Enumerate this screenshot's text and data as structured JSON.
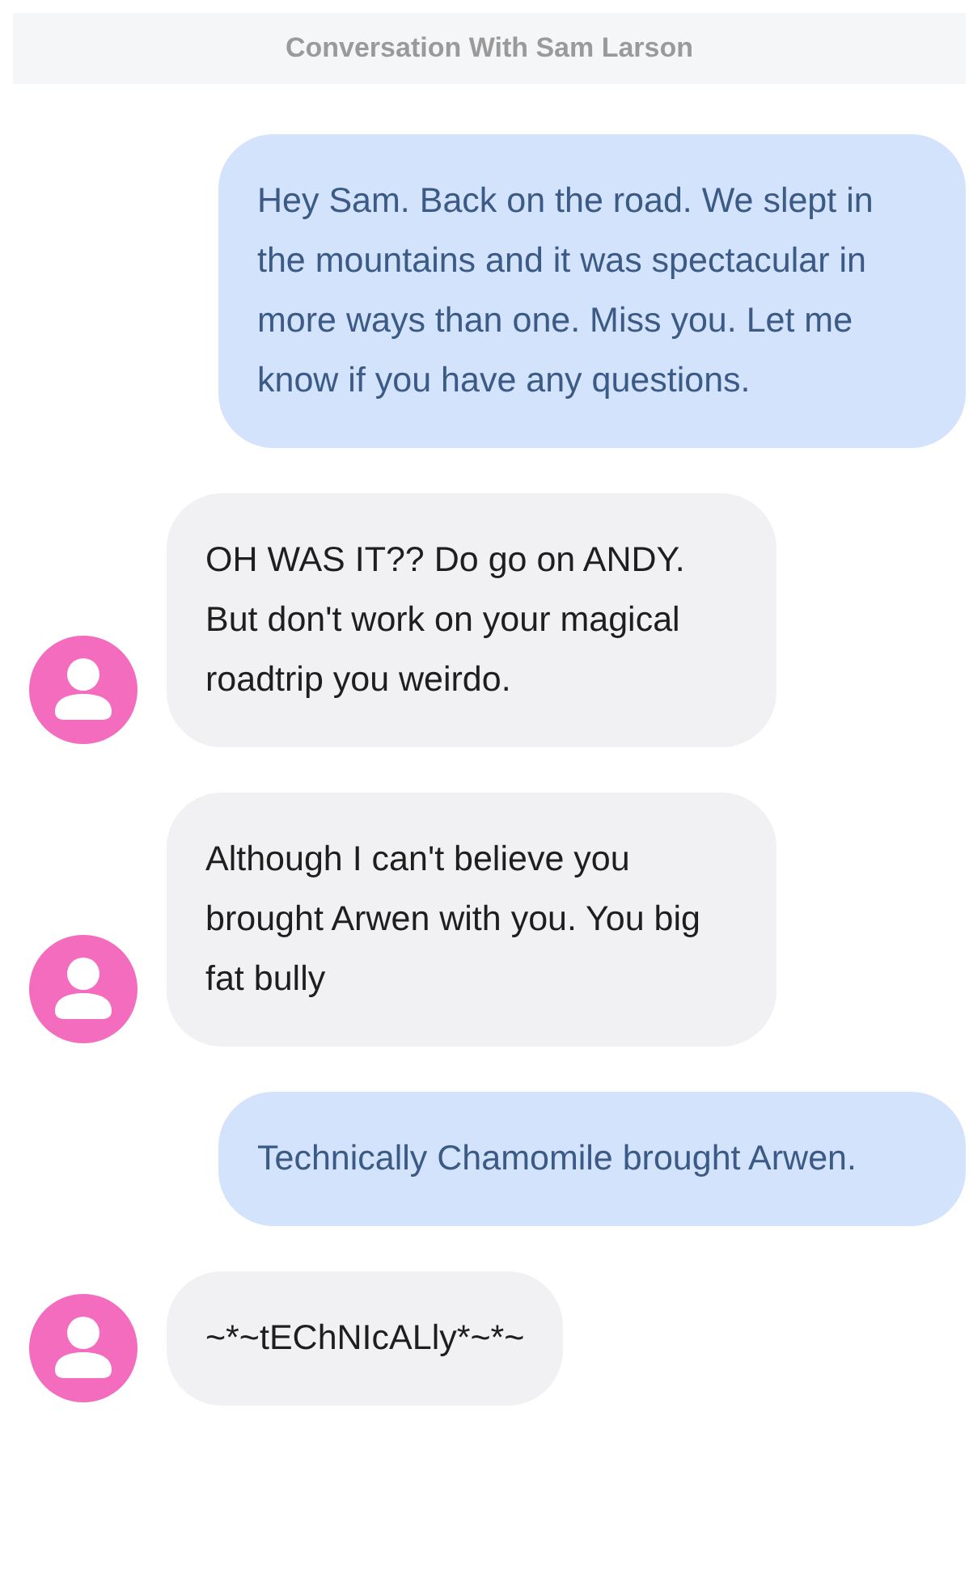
{
  "header": {
    "title": "Conversation With Sam Larson"
  },
  "messages": [
    {
      "kind": "sent",
      "text": "Hey Sam. Back on the road. We slept in the mountains and it was spectacular in more ways than one. Miss you. Let me know if you have any questions."
    },
    {
      "kind": "received",
      "text": "OH WAS IT?? Do go on ANDY. But don't work on your magical roadtrip you weirdo."
    },
    {
      "kind": "received",
      "text": "Although I can't believe you brought Arwen with you. You big fat bully"
    },
    {
      "kind": "sent",
      "text": "Technically Chamomile brought Arwen."
    },
    {
      "kind": "received",
      "text": "~*~tEChNIcALly*~*~"
    }
  ]
}
